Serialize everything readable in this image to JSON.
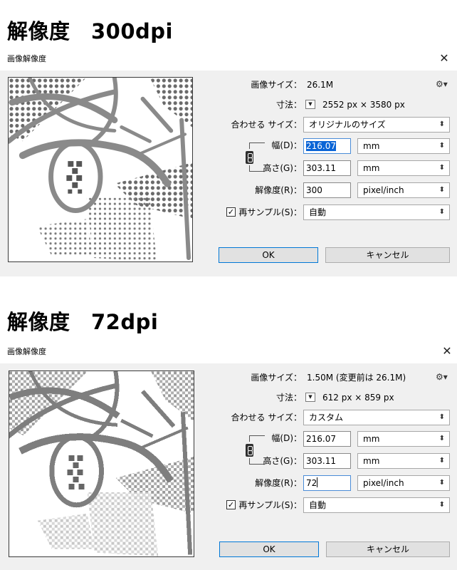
{
  "sections": [
    {
      "heading": "解像度　300dpi",
      "dialog_title": "画像解像度",
      "image_size_label": "画像サイズ：",
      "image_size_value": "26.1M",
      "dimensions_label": "寸法：",
      "dimensions_value": "2552 px × 3580 px",
      "fit_label": "合わせる サイズ：",
      "fit_value": "オリジナルのサイズ",
      "width_label": "幅(D)：",
      "width_value": "216.07",
      "width_unit": "mm",
      "height_label": "高さ(G)：",
      "height_value": "303.11",
      "height_unit": "mm",
      "resolution_label": "解像度(R)：",
      "resolution_value": "300",
      "resolution_unit": "pixel/inch",
      "resample_label": "再サンプル(S)：",
      "resample_value": "自動",
      "ok_label": "OK",
      "cancel_label": "キャンセル"
    },
    {
      "heading": "解像度　72dpi",
      "dialog_title": "画像解像度",
      "image_size_label": "画像サイズ：",
      "image_size_value": "1.50M (変更前は 26.1M)",
      "dimensions_label": "寸法：",
      "dimensions_value": "612 px × 859 px",
      "fit_label": "合わせる サイズ：",
      "fit_value": "カスタム",
      "width_label": "幅(D)：",
      "width_value": "216.07",
      "width_unit": "mm",
      "height_label": "高さ(G)：",
      "height_value": "303.11",
      "height_unit": "mm",
      "resolution_label": "解像度(R)：",
      "resolution_value": "72",
      "resolution_unit": "pixel/inch",
      "resample_label": "再サンプル(S)：",
      "resample_value": "自動",
      "ok_label": "OK",
      "cancel_label": "キャンセル"
    }
  ],
  "icons": {
    "close": "close-icon",
    "gear": "gear-icon",
    "dropdown": "chevron-down-icon",
    "link": "chain-link-icon",
    "checkbox": "check-icon"
  },
  "colors": {
    "panel_bg": "#f0f0f0",
    "selection": "#0a64d6",
    "focus_border": "#4a8cd7",
    "ok_border": "#0078d7"
  }
}
